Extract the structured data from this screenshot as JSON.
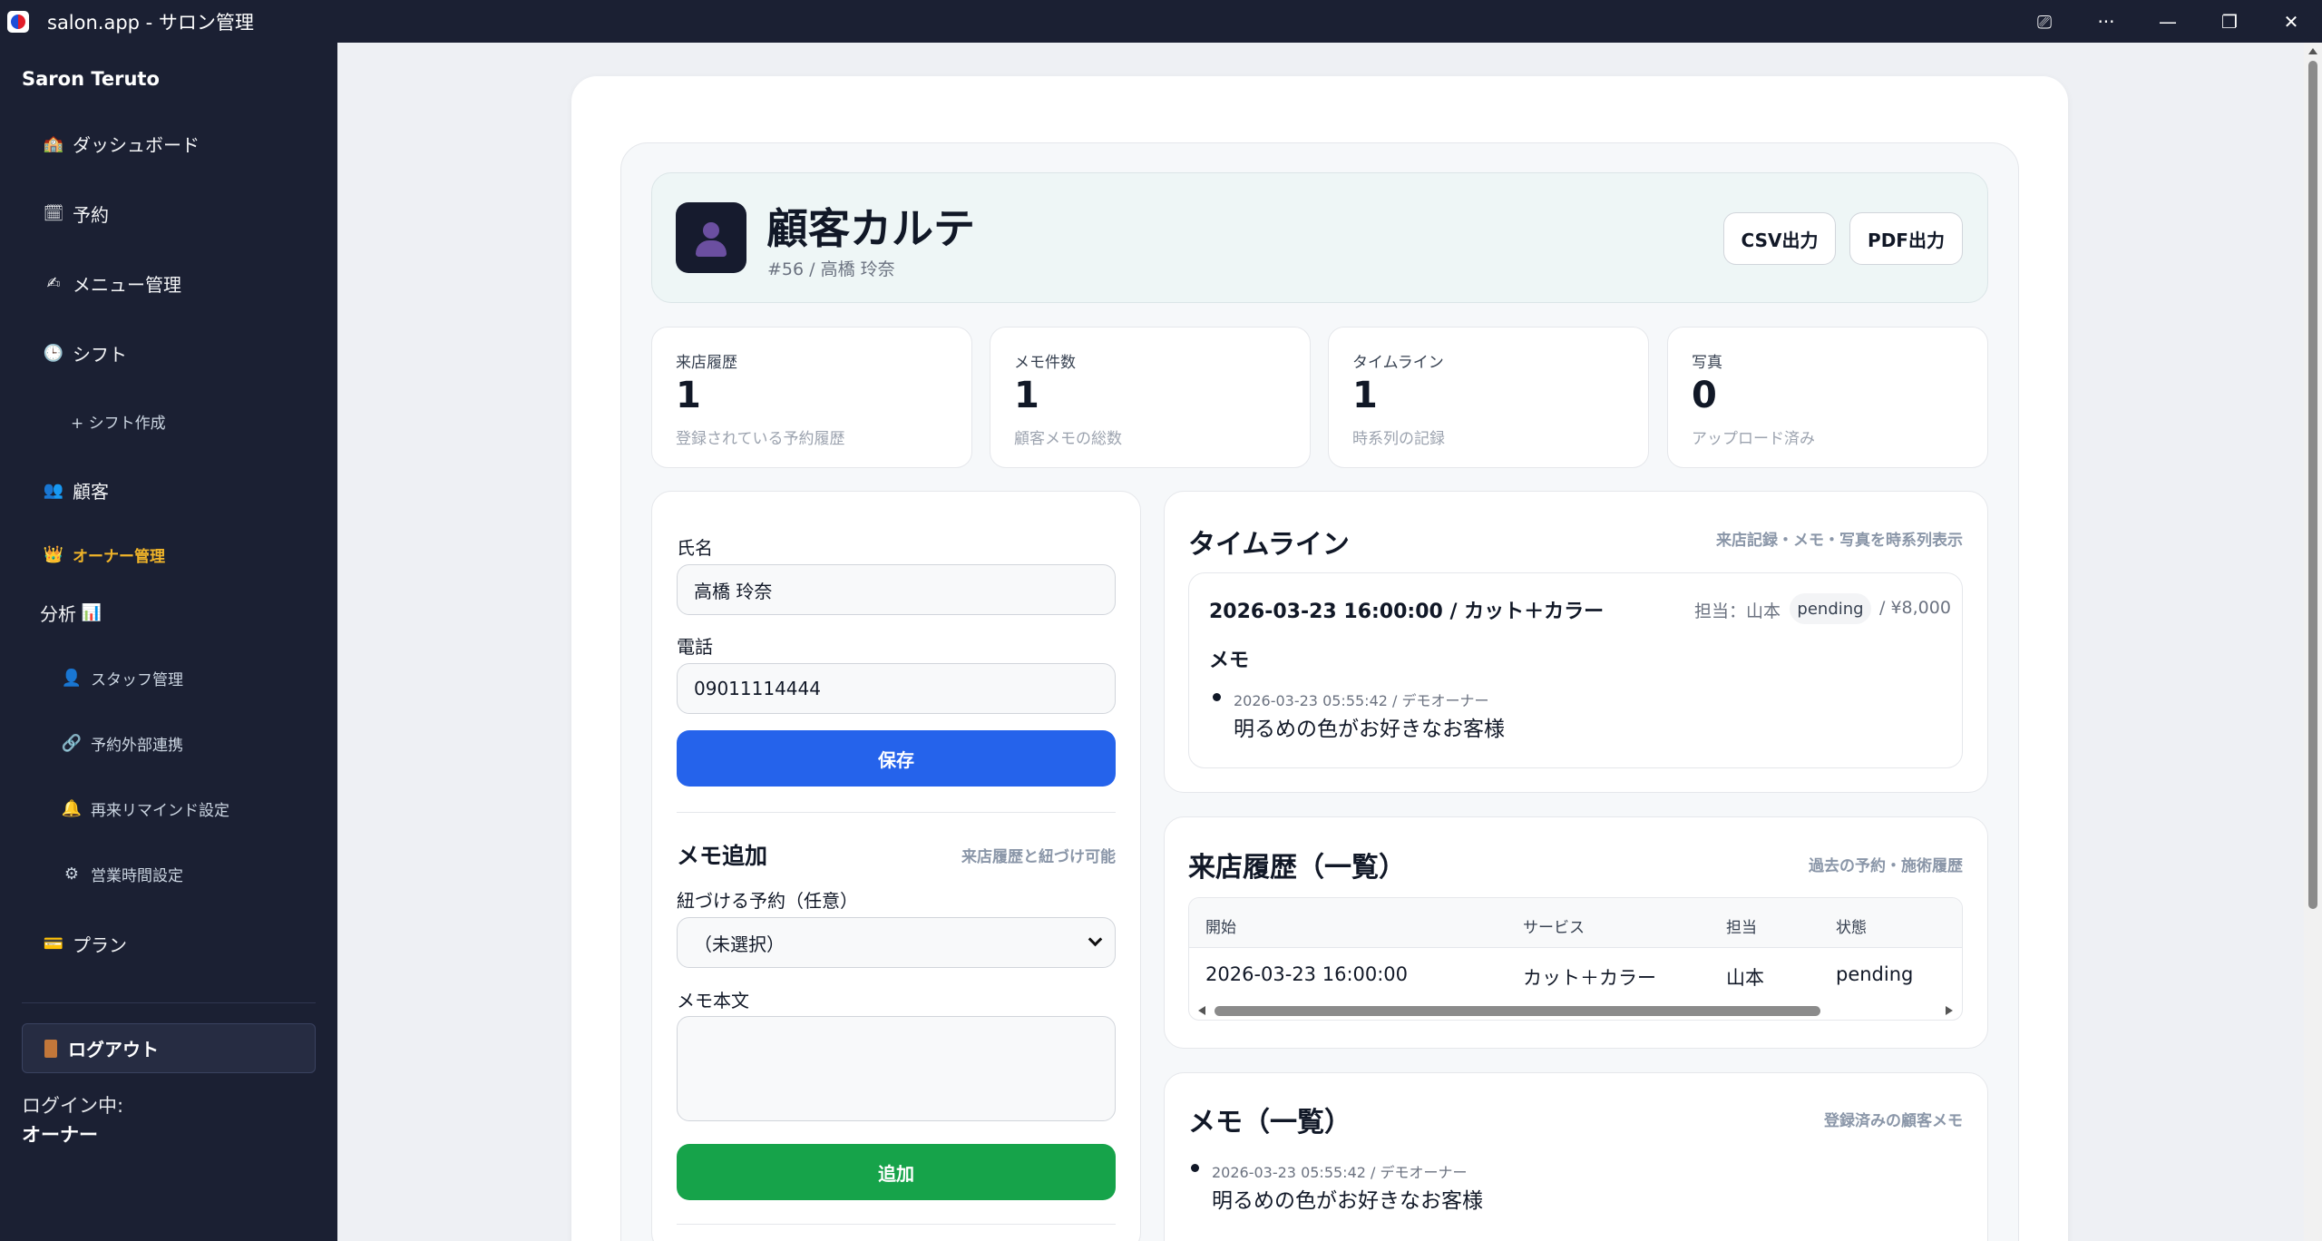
{
  "window": {
    "title": "salon.app - サロン管理",
    "controls": {
      "cast": "⎚",
      "more": "···",
      "minimize": "—",
      "restore": "❐",
      "close": "✕"
    }
  },
  "sidebar": {
    "brand": "Saron Teruto",
    "items": [
      {
        "icon": "🏫",
        "label": "ダッシュボード"
      },
      {
        "icon": "🗓",
        "label": "予約"
      },
      {
        "icon": "✍",
        "label": "メニュー管理"
      },
      {
        "icon": "🕒",
        "label": "シフト"
      },
      {
        "icon": "",
        "label": "+ シフト作成"
      },
      {
        "icon": "👥",
        "label": "顧客"
      },
      {
        "icon": "👑",
        "label": "オーナー管理"
      },
      {
        "icon": "📊",
        "label": "分析"
      },
      {
        "icon": "👤",
        "label": "スタッフ管理"
      },
      {
        "icon": "🔗",
        "label": "予約外部連携"
      },
      {
        "icon": "🔔",
        "label": "再来リマインド設定"
      },
      {
        "icon": "⚙",
        "label": "営業時間設定"
      },
      {
        "icon": "💳",
        "label": "プラン"
      }
    ],
    "logout": "ログアウト",
    "login_label": "ログイン中:",
    "login_user": "オーナー"
  },
  "header": {
    "title": "顧客カルテ",
    "subtitle": "#56 / 高橋 玲奈",
    "csv_button": "CSV出力",
    "pdf_button": "PDF出力"
  },
  "stats": [
    {
      "label": "来店履歴",
      "value": "1",
      "desc": "登録されている予約履歴"
    },
    {
      "label": "メモ件数",
      "value": "1",
      "desc": "顧客メモの総数"
    },
    {
      "label": "タイムライン",
      "value": "1",
      "desc": "時系列の記録"
    },
    {
      "label": "写真",
      "value": "0",
      "desc": "アップロード済み"
    }
  ],
  "form": {
    "name_label": "氏名",
    "name_value": "高橋 玲奈",
    "phone_label": "電話",
    "phone_value": "09011114444",
    "save_button": "保存",
    "memo_title": "メモ追加",
    "memo_hint": "来店履歴と紐づけ可能",
    "link_label": "紐づける予約（任意）",
    "link_selected": "（未選択）",
    "memo_body_label": "メモ本文",
    "memo_body_value": "",
    "add_button": "追加"
  },
  "timeline": {
    "title": "タイムライン",
    "hint": "来店記録・メモ・写真を時系列表示",
    "entry": {
      "heading": "2026-03-23 16:00:00 / カット＋カラー",
      "staff": "担当：山本",
      "status": "pending",
      "price": "/ ¥8,000",
      "memo_label": "メモ",
      "memo_meta": "2026-03-23 05:55:42 / デモオーナー",
      "memo_text": "明るめの色がお好きなお客様"
    }
  },
  "history": {
    "title": "来店履歴（一覧）",
    "hint": "過去の予約・施術履歴",
    "columns": [
      "開始",
      "サービス",
      "担当",
      "状態"
    ],
    "rows": [
      [
        "2026-03-23 16:00:00",
        "カット＋カラー",
        "山本",
        "pending"
      ]
    ]
  },
  "memos": {
    "title": "メモ（一覧）",
    "hint": "登録済みの顧客メモ",
    "items": [
      {
        "meta": "2026-03-23 05:55:42 / デモオーナー",
        "text": "明るめの色がお好きなお客様"
      }
    ]
  },
  "colors": {
    "sidebar_bg": "#1b2033",
    "primary": "#2563eb",
    "success": "#16a34a",
    "owner_accent": "#f0b429"
  }
}
